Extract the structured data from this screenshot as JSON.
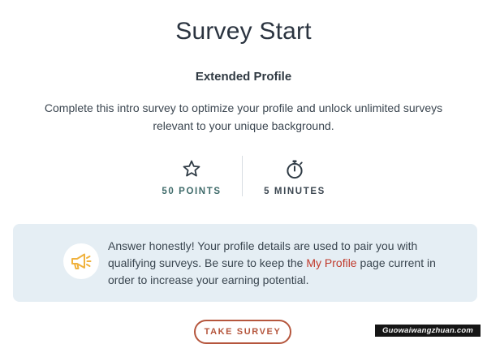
{
  "header": {
    "title": "Survey Start",
    "subtitle": "Extended Profile"
  },
  "intro": {
    "description": "Complete this intro survey to optimize your profile and unlock unlimited surveys relevant to your unique background."
  },
  "stats": {
    "points": {
      "icon": "star-icon",
      "label": "50 POINTS"
    },
    "time": {
      "icon": "stopwatch-icon",
      "label": "5 MINUTES"
    }
  },
  "notice": {
    "icon": "megaphone-icon",
    "text_before": "Answer honestly! Your profile details are used to pair you with qualifying surveys. Be sure to keep the ",
    "link_label": "My Profile",
    "text_after": " page current in order to increase your earning potential."
  },
  "actions": {
    "take_survey_label": "TAKE SURVEY"
  },
  "watermark": {
    "text": "Guowaiwangzhuan.com"
  },
  "colors": {
    "accent": "#b5563d",
    "link": "#c0392b",
    "notice_bg": "#e5eef4",
    "megaphone": "#f0b23e"
  }
}
